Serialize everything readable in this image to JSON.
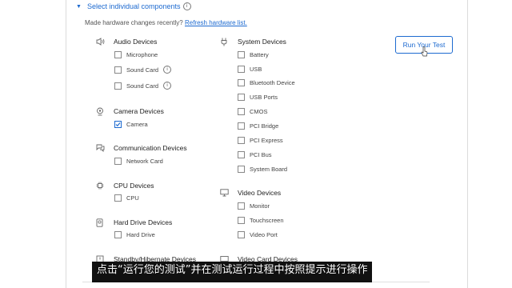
{
  "header": {
    "title": "Select individual components",
    "info": "i"
  },
  "prompt": {
    "text": "Made hardware changes recently?",
    "link": "Refresh hardware list."
  },
  "run_button": {
    "label": "Run Your Test"
  },
  "groups": {
    "audio": {
      "title": "Audio Devices",
      "icon": "speaker-icon",
      "items": [
        "Microphone",
        "Sound Card",
        "Sound Card"
      ]
    },
    "camera": {
      "title": "Camera Devices",
      "icon": "webcam-icon",
      "items": [
        "Camera"
      ]
    },
    "communication": {
      "title": "Communication Devices",
      "icon": "chat-icon",
      "items": [
        "Network Card"
      ]
    },
    "cpu": {
      "title": "CPU Devices",
      "icon": "chip-icon",
      "items": [
        "CPU"
      ]
    },
    "hdd": {
      "title": "Hard Drive Devices",
      "icon": "hard-drive-icon",
      "items": [
        "Hard Drive"
      ]
    },
    "standby": {
      "title": "Standby/Hibernate Devices",
      "icon": "power-icon"
    },
    "system": {
      "title": "System Devices",
      "icon": "plug-icon",
      "items": [
        "Battery",
        "USB",
        "Bluetooth Device",
        "USB Ports",
        "CMOS",
        "PCI Bridge",
        "PCI Express",
        "PCI Bus",
        "System Board"
      ]
    },
    "video": {
      "title": "Video Devices",
      "icon": "monitor-icon",
      "items": [
        "Monitor",
        "Touchscreen",
        "Video Port"
      ]
    },
    "video_card": {
      "title": "Video Card Devices",
      "icon": "card-icon"
    }
  },
  "checked_items": [
    "Camera"
  ],
  "subtitle": "点击“运行您的测试”并在测试运行过程中按照提示进行操作",
  "colors": {
    "accent": "#1d6ad0",
    "text": "#333333"
  }
}
